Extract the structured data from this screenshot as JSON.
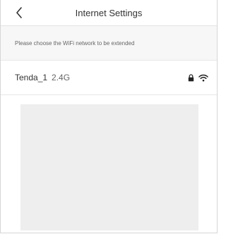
{
  "header": {
    "title": "Internet Settings",
    "back_icon": "chevron-left-icon"
  },
  "hint": {
    "text": "Please choose the WiFi network to be extended"
  },
  "network": {
    "ssid": "Tenda_1",
    "band": "2.4G",
    "security_icon": "lock-icon",
    "signal_icon": "wifi-signal-icon"
  },
  "colors": {
    "text_primary": "#333333",
    "text_secondary": "#666666",
    "placeholder_area": "#eeeeee",
    "divider": "#e6e6e6"
  }
}
